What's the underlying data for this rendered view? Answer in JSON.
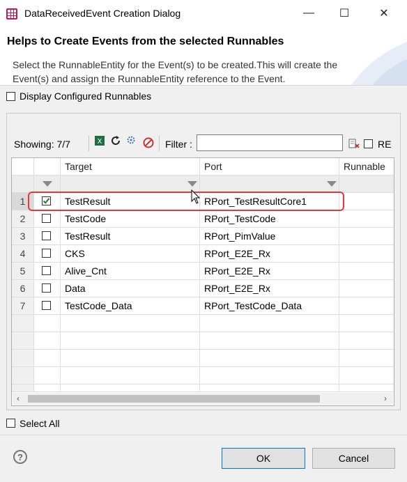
{
  "window": {
    "title": "DataReceivedEvent Creation Dialog",
    "minimize": "—",
    "maximize": "☐",
    "close": "✕"
  },
  "header": {
    "title": "Helps to Create Events from the selected Runnables",
    "description": "Select the RunnableEntity for the Event(s) to be created.This will create the Event(s) and assign the RunnableEntity reference to the Event."
  },
  "display_configured": {
    "label": "Display Configured Runnables",
    "checked": false
  },
  "toolbar": {
    "showing": "Showing: 7/7",
    "filter_label": "Filter :",
    "filter_value": "",
    "re_label": "RE"
  },
  "table": {
    "columns": [
      "Target",
      "Port",
      "Runnable"
    ],
    "rows": [
      {
        "num": "1",
        "checked": true,
        "target": "TestResult",
        "port": "RPort_TestResultCore1",
        "runnable": ""
      },
      {
        "num": "2",
        "checked": false,
        "target": "TestCode",
        "port": "RPort_TestCode",
        "runnable": ""
      },
      {
        "num": "3",
        "checked": false,
        "target": "TestResult",
        "port": "RPort_PimValue",
        "runnable": ""
      },
      {
        "num": "4",
        "checked": false,
        "target": "CKS",
        "port": "RPort_E2E_Rx",
        "runnable": ""
      },
      {
        "num": "5",
        "checked": false,
        "target": "Alive_Cnt",
        "port": "RPort_E2E_Rx",
        "runnable": ""
      },
      {
        "num": "6",
        "checked": false,
        "target": "Data",
        "port": "RPort_E2E_Rx",
        "runnable": ""
      },
      {
        "num": "7",
        "checked": false,
        "target": "TestCode_Data",
        "port": "RPort_TestCode_Data",
        "runnable": ""
      }
    ]
  },
  "select_all": {
    "label": "Select All",
    "checked": false
  },
  "buttons": {
    "ok": "OK",
    "cancel": "Cancel",
    "help": "?"
  },
  "colors": {
    "accent": "#0078d7",
    "selection_outline": "#e03b3b",
    "check": "#1e7d1e"
  }
}
